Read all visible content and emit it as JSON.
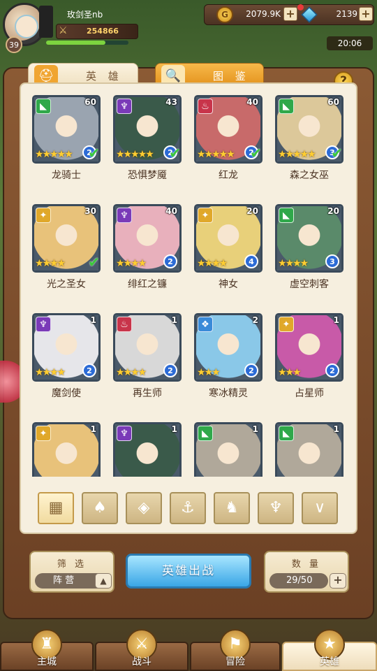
{
  "player": {
    "name": "玫剑圣nb",
    "level": "39",
    "power": "254866",
    "exp_fraction": 0.72
  },
  "resources": {
    "gold": "2079.9K",
    "gems": "2139",
    "plus_symbol": "+"
  },
  "clock": "20:06",
  "tabs": [
    {
      "label": "英 雄",
      "icon": "helmet-icon"
    },
    {
      "label": "图 鉴",
      "icon": "magnifier-icon"
    }
  ],
  "help_label": "?",
  "heroes": [
    {
      "name": "龙骑士",
      "level": "60",
      "faction": "dragon",
      "stars": 5,
      "count": "2",
      "checked": true
    },
    {
      "name": "恐惧梦魇",
      "level": "43",
      "faction": "demon",
      "stars": 5,
      "count": "2",
      "checked": true
    },
    {
      "name": "红龙",
      "level": "40",
      "faction": "fire",
      "stars": 5,
      "count": "2",
      "checked": true
    },
    {
      "name": "森之女巫",
      "level": "60",
      "faction": "dragon",
      "stars": 5,
      "count": "3",
      "checked": true
    },
    {
      "name": "光之圣女",
      "level": "30",
      "faction": "light",
      "stars": 4,
      "count": "",
      "checked": true
    },
    {
      "name": "绯红之镰",
      "level": "40",
      "faction": "demon",
      "stars": 4,
      "count": "2",
      "checked": false
    },
    {
      "name": "神女",
      "level": "20",
      "faction": "light",
      "stars": 4,
      "count": "4",
      "checked": false
    },
    {
      "name": "虚空刺客",
      "level": "20",
      "faction": "dragon",
      "stars": 4,
      "count": "3",
      "checked": false
    },
    {
      "name": "魔剑使",
      "level": "1",
      "faction": "demon",
      "stars": 4,
      "count": "2",
      "checked": false
    },
    {
      "name": "再生师",
      "level": "1",
      "faction": "fire",
      "stars": 4,
      "count": "2",
      "checked": false
    },
    {
      "name": "寒冰精灵",
      "level": "2",
      "faction": "ice",
      "stars": 3,
      "count": "2",
      "checked": false
    },
    {
      "name": "占星师",
      "level": "1",
      "faction": "light",
      "stars": 3,
      "count": "2",
      "checked": false
    },
    {
      "name": "",
      "level": "1",
      "faction": "light",
      "stars": 0,
      "count": "",
      "checked": false
    },
    {
      "name": "",
      "level": "1",
      "faction": "demon",
      "stars": 0,
      "count": "",
      "checked": false
    },
    {
      "name": "",
      "level": "1",
      "faction": "dragon",
      "stars": 0,
      "count": "",
      "checked": false
    },
    {
      "name": "",
      "level": "1",
      "faction": "dragon",
      "stars": 0,
      "count": "",
      "checked": false
    }
  ],
  "faction_colors": {
    "dragon": "#2fa84a",
    "demon": "#7a3ab8",
    "fire": "#c8344a",
    "light": "#e0a82a",
    "ice": "#3a8ad8"
  },
  "filters": [
    {
      "icon": "grid-all-icon",
      "active": true
    },
    {
      "icon": "leaf-icon",
      "active": false
    },
    {
      "icon": "diamond-layers-icon",
      "active": false
    },
    {
      "icon": "anchor-icon",
      "active": false
    },
    {
      "icon": "dragon-head-icon",
      "active": false
    },
    {
      "icon": "demon-horns-icon",
      "active": false
    },
    {
      "icon": "chevron-wings-icon",
      "active": false
    }
  ],
  "filter_panel": {
    "title": "筛 选",
    "value": "阵 营",
    "arrow": "▲"
  },
  "deploy_label": "英雄出战",
  "quantity_panel": {
    "title": "数 量",
    "value": "29/50",
    "plus": "+"
  },
  "nav": [
    {
      "label": "主城",
      "icon": "castle-icon",
      "active": false
    },
    {
      "label": "战斗",
      "icon": "crossed-swords-icon",
      "active": false
    },
    {
      "label": "冒险",
      "icon": "map-scroll-icon",
      "active": false
    },
    {
      "label": "英雄",
      "icon": "hero-crest-icon",
      "active": true
    }
  ]
}
